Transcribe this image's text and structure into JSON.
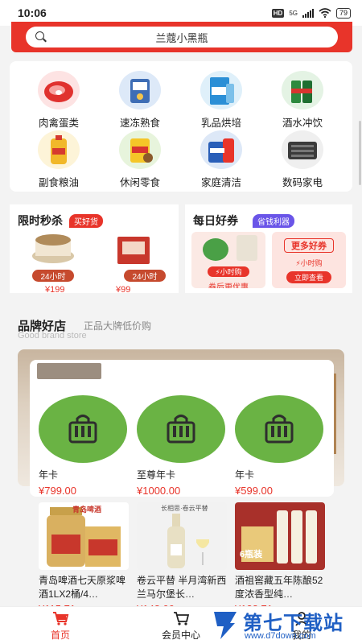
{
  "status": {
    "time": "10:06",
    "hd": "HD",
    "network": "5G",
    "battery": "79"
  },
  "search": {
    "placeholder": "兰蔻小黑瓶"
  },
  "categories": [
    {
      "label": "肉禽蛋类",
      "icon": "meat-icon"
    },
    {
      "label": "速冻熟食",
      "icon": "frozen-food-icon"
    },
    {
      "label": "乳品烘培",
      "icon": "dairy-icon"
    },
    {
      "label": "酒水冲饮",
      "icon": "drinks-icon"
    },
    {
      "label": "副食粮油",
      "icon": "oil-icon"
    },
    {
      "label": "休闲零食",
      "icon": "snacks-icon"
    },
    {
      "label": "家庭清洁",
      "icon": "cleaning-icon"
    },
    {
      "label": "数码家电",
      "icon": "appliance-icon"
    }
  ],
  "flash_sale": {
    "title": "限时秒杀",
    "tag": "买好货",
    "items": [
      {
        "badge": "24小时",
        "price": "¥199"
      },
      {
        "badge": "24小时",
        "price": "¥99"
      }
    ]
  },
  "daily_coupon": {
    "title": "每日好券",
    "tag": "省钱利器",
    "left": {
      "badge": "小时购",
      "caption": "券后更优惠"
    },
    "right": {
      "title": "更多好券",
      "badge": "小时购",
      "button": "立即查看"
    }
  },
  "brand": {
    "title": "品牌好店",
    "subtitle": "正品大牌低价购",
    "english": "Good brand store"
  },
  "member_cards": [
    {
      "name": "年卡",
      "price": "¥799.00"
    },
    {
      "name": "至尊年卡",
      "price": "¥1000.00"
    },
    {
      "name": "年卡",
      "price": "¥599.00"
    }
  ],
  "products": [
    {
      "name": "青岛啤酒七天原浆啤酒1LX2桶/4…",
      "price": "¥115.71",
      "label": "青岛啤酒"
    },
    {
      "name": "卷云平替 半月湾新西兰马尔堡长…",
      "price": "¥148.00",
      "label": "长相思·卷云平替"
    },
    {
      "name": "酒祖窖藏五年陈酿52度浓香型纯…",
      "price": "¥138.71",
      "label": "6瓶装"
    }
  ],
  "tabs": [
    {
      "label": "首页",
      "active": true
    },
    {
      "label": "会员中心",
      "active": false
    },
    {
      "label": "我的",
      "active": false
    }
  ],
  "watermark": {
    "title": "第七下载站",
    "url": "www.d7down.com"
  },
  "colors": {
    "brand_red": "#e8342a",
    "card_green": "#6ab344"
  }
}
